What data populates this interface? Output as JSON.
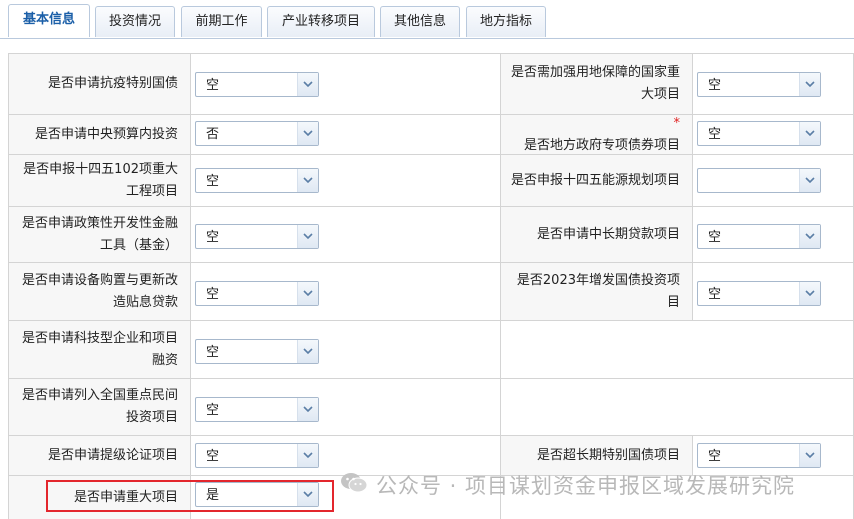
{
  "tabs": [
    "基本信息",
    "投资情况",
    "前期工作",
    "产业转移项目",
    "其他信息",
    "地方指标"
  ],
  "fields": {
    "f1": {
      "label": "是否申请抗疫特别国债",
      "value": "空"
    },
    "f2": {
      "label": "是否需加强用地保障的国家重大项目",
      "value": "空"
    },
    "f3": {
      "label": "是否申请中央预算内投资",
      "value": "否"
    },
    "f4": {
      "label": "是否地方政府专项债券项目",
      "value": "空",
      "required": "*"
    },
    "f5": {
      "label": "是否申报十四五102项重大工程项目",
      "value": "空"
    },
    "f6": {
      "label": "是否申报十四五能源规划项目",
      "value": ""
    },
    "f7": {
      "label": "是否申请政策性开发性金融工具（基金）",
      "value": "空"
    },
    "f8": {
      "label": "是否申请中长期贷款项目",
      "value": "空"
    },
    "f9": {
      "label": "是否申请设备购置与更新改造贴息贷款",
      "value": "空"
    },
    "f10": {
      "label": "是否2023年增发国债投资项目",
      "value": "空"
    },
    "f11": {
      "label": "是否申请科技型企业和项目融资",
      "value": "空"
    },
    "f12": {
      "label": "是否申请列入全国重点民间投资项目",
      "value": "空"
    },
    "f13": {
      "label": "是否申请提级论证项目",
      "value": "空"
    },
    "f14": {
      "label": "是否超长期特别国债项目",
      "value": "空"
    },
    "f15": {
      "label": "是否申请重大项目",
      "value": "是"
    }
  },
  "watermark": {
    "text": "公众号 · 项目谋划资金申报区域发展研究院",
    "icon": "wechat-icon"
  },
  "colors": {
    "active_tab": "#1b5fa8",
    "highlight_box": "#e3262d",
    "required": "#e02020"
  }
}
